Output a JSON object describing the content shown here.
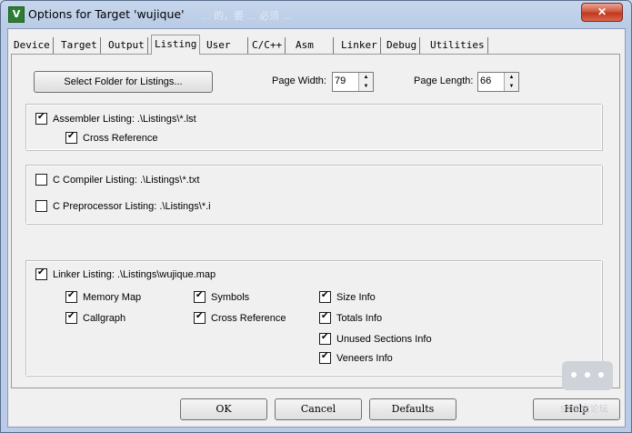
{
  "window": {
    "title": "Options for Target 'wujique'",
    "title_noise": "… 的，要 … 必须 …",
    "close_label": "✕"
  },
  "tabs": [
    {
      "label": "Device"
    },
    {
      "label": "Target"
    },
    {
      "label": "Output"
    },
    {
      "label": "Listing"
    },
    {
      "label": "User"
    },
    {
      "label": "C/C++"
    },
    {
      "label": "Asm"
    },
    {
      "label": "Linker"
    },
    {
      "label": "Debug"
    },
    {
      "label": "Utilities"
    }
  ],
  "listing": {
    "select_folder_label": "Select Folder for Listings...",
    "page_width_label": "Page Width:",
    "page_width_value": "79",
    "page_length_label": "Page Length:",
    "page_length_value": "66",
    "assembler": {
      "label": "Assembler Listing:  .\\Listings\\*.lst",
      "checked": true,
      "cross_reference": {
        "label": "Cross Reference",
        "checked": true
      }
    },
    "c_compiler": {
      "label": "C Compiler Listing:  .\\Listings\\*.txt",
      "checked": false
    },
    "c_preprocessor": {
      "label": "C Preprocessor Listing:  .\\Listings\\*.i",
      "checked": false
    },
    "linker": {
      "label": "Linker Listing:  .\\Listings\\wujique.map",
      "checked": true,
      "options": {
        "memory_map": {
          "label": "Memory Map",
          "checked": true
        },
        "callgraph": {
          "label": "Callgraph",
          "checked": true
        },
        "symbols": {
          "label": "Symbols",
          "checked": true
        },
        "cross_reference": {
          "label": "Cross Reference",
          "checked": true
        },
        "size_info": {
          "label": "Size Info",
          "checked": true
        },
        "totals_info": {
          "label": "Totals Info",
          "checked": true
        },
        "unused_sections_info": {
          "label": "Unused Sections Info",
          "checked": true
        },
        "veneers_info": {
          "label": "Veneers Info",
          "checked": true
        }
      }
    }
  },
  "buttons": {
    "ok": "OK",
    "cancel": "Cancel",
    "defaults": "Defaults",
    "help": "Help"
  },
  "watermark": {
    "text": "ST中文论坛"
  }
}
